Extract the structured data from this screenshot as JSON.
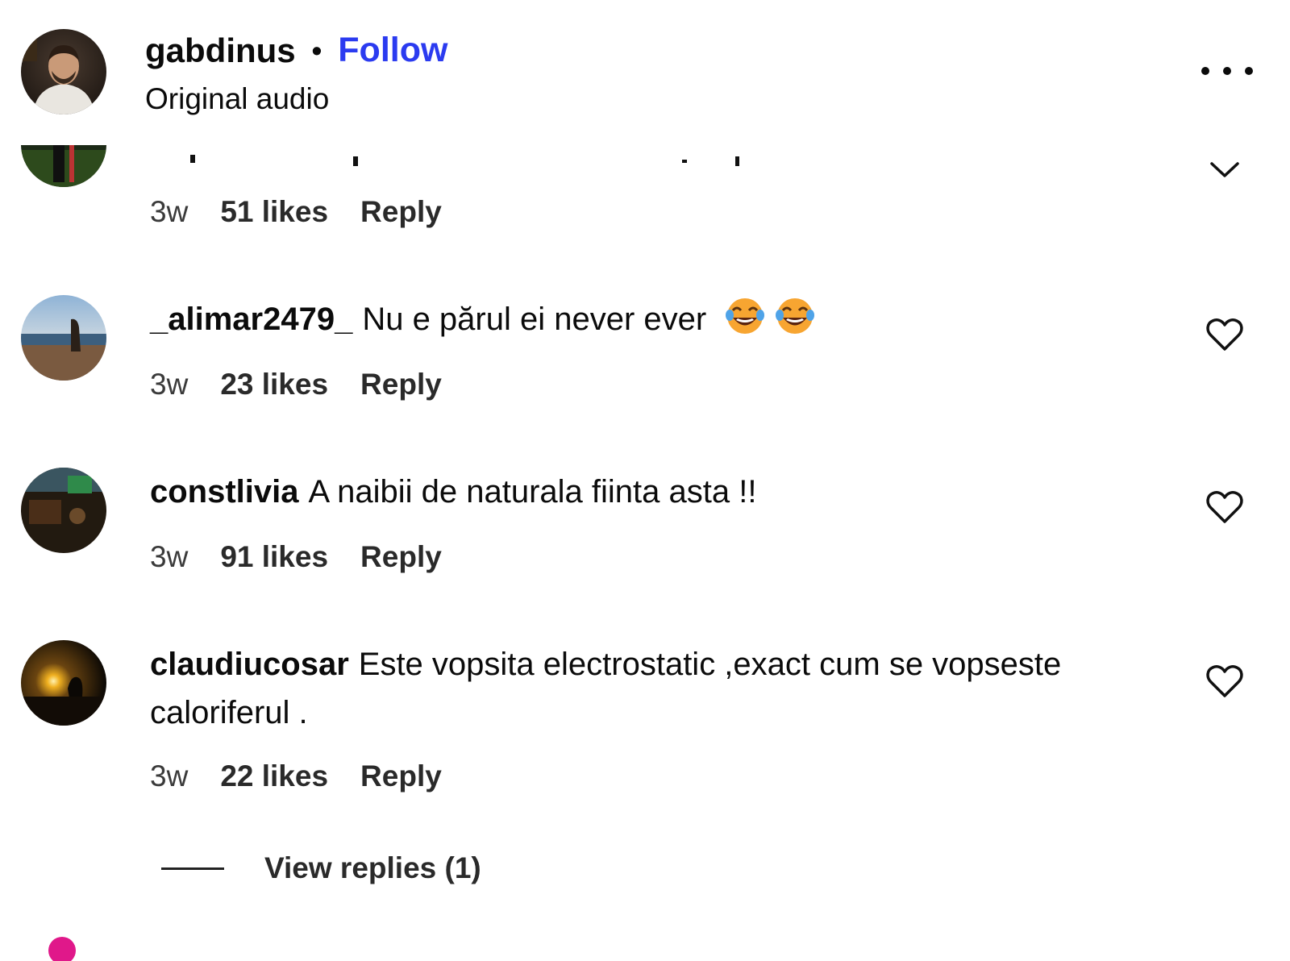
{
  "header": {
    "username": "gabdinus",
    "separator": "•",
    "follow_label": "Follow",
    "subtitle": "Original audio",
    "more_icon": "more-horizontal-icon"
  },
  "comments": [
    {
      "time": "3w",
      "likes": "51 likes",
      "reply_label": "Reply",
      "action_icon": "chevron-down-icon"
    },
    {
      "username": "_alimar2479_",
      "text": "Nu e părul ei never ever",
      "emoji": [
        "tears-of-joy-emoji",
        "tears-of-joy-emoji"
      ],
      "time": "3w",
      "likes": "23 likes",
      "reply_label": "Reply",
      "action_icon": "heart-icon"
    },
    {
      "username": "constlivia",
      "text": "A naibii de naturala fiinta asta !!",
      "time": "3w",
      "likes": "91 likes",
      "reply_label": "Reply",
      "action_icon": "heart-icon"
    },
    {
      "username": "claudiucosar",
      "text": "Este vopsita electrostatic ,exact cum se vopseste caloriferul .",
      "time": "3w",
      "likes": "22 likes",
      "reply_label": "Reply",
      "action_icon": "heart-icon",
      "view_replies_label": "View replies (1)"
    }
  ],
  "colors": {
    "follow": "#2b3bf0",
    "text": "#0b0b0b",
    "meta": "#2a2a2a"
  }
}
